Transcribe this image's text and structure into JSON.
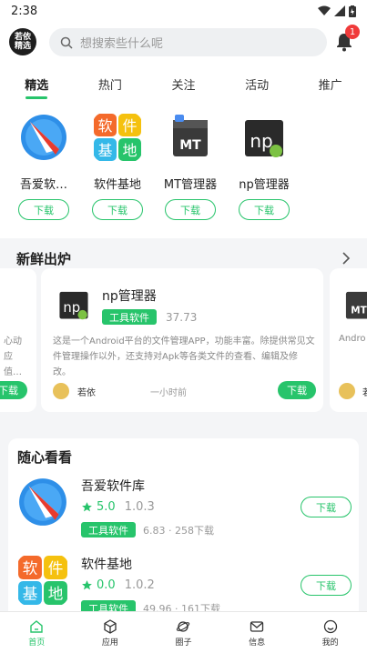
{
  "status": {
    "time": "2:38"
  },
  "header": {
    "logo_text": "若依\n精选",
    "search_placeholder": "想搜索些什么呢",
    "notification_count": "1"
  },
  "tabs": [
    {
      "label": "精选",
      "active": true
    },
    {
      "label": "热门"
    },
    {
      "label": "关注"
    },
    {
      "label": "活动"
    },
    {
      "label": "推广"
    }
  ],
  "hot_apps": [
    {
      "name": "吾爱软…",
      "button": "下载",
      "icon": "compass-app-icon"
    },
    {
      "name": "软件基地",
      "button": "下载",
      "icon": "software-base-icon"
    },
    {
      "name": "MT管理器",
      "button": "下载",
      "icon": "mt-manager-icon"
    },
    {
      "name": "np管理器",
      "button": "下载",
      "icon": "np-manager-icon"
    }
  ],
  "fresh": {
    "title": "新鲜出炉",
    "card": {
      "name": "np管理器",
      "tag": "工具软件",
      "size": "37.73",
      "desc": "这是一个Android平台的文件管理APP，功能丰富。除提供常见文件管理操作以外，还支持对Apk等各类文件的查看、编辑及修改。",
      "author": "若依",
      "time": "一小时前",
      "button": "下载"
    },
    "left_card": {
      "desc_lines": [
        "心动",
        "应",
        "值…"
      ],
      "button": "下载"
    },
    "right_card": {
      "desc": "Andro",
      "author": "若"
    }
  },
  "random": {
    "title": "随心看看",
    "items": [
      {
        "name": "吾爱软件库",
        "rating": "5.0",
        "version": "1.0.3",
        "tag": "工具软件",
        "meta": "6.83 · 258下载",
        "button": "下载"
      },
      {
        "name": "软件基地",
        "rating": "0.0",
        "version": "1.0.2",
        "tag": "工具软件",
        "meta": "49.96 · 161下载",
        "button": "下载"
      }
    ]
  },
  "bottom_nav": [
    {
      "label": "首页",
      "active": true
    },
    {
      "label": "应用"
    },
    {
      "label": "圈子"
    },
    {
      "label": "信息"
    },
    {
      "label": "我的"
    }
  ],
  "colors": {
    "accent": "#27c46b",
    "badge": "#f03a3a"
  }
}
